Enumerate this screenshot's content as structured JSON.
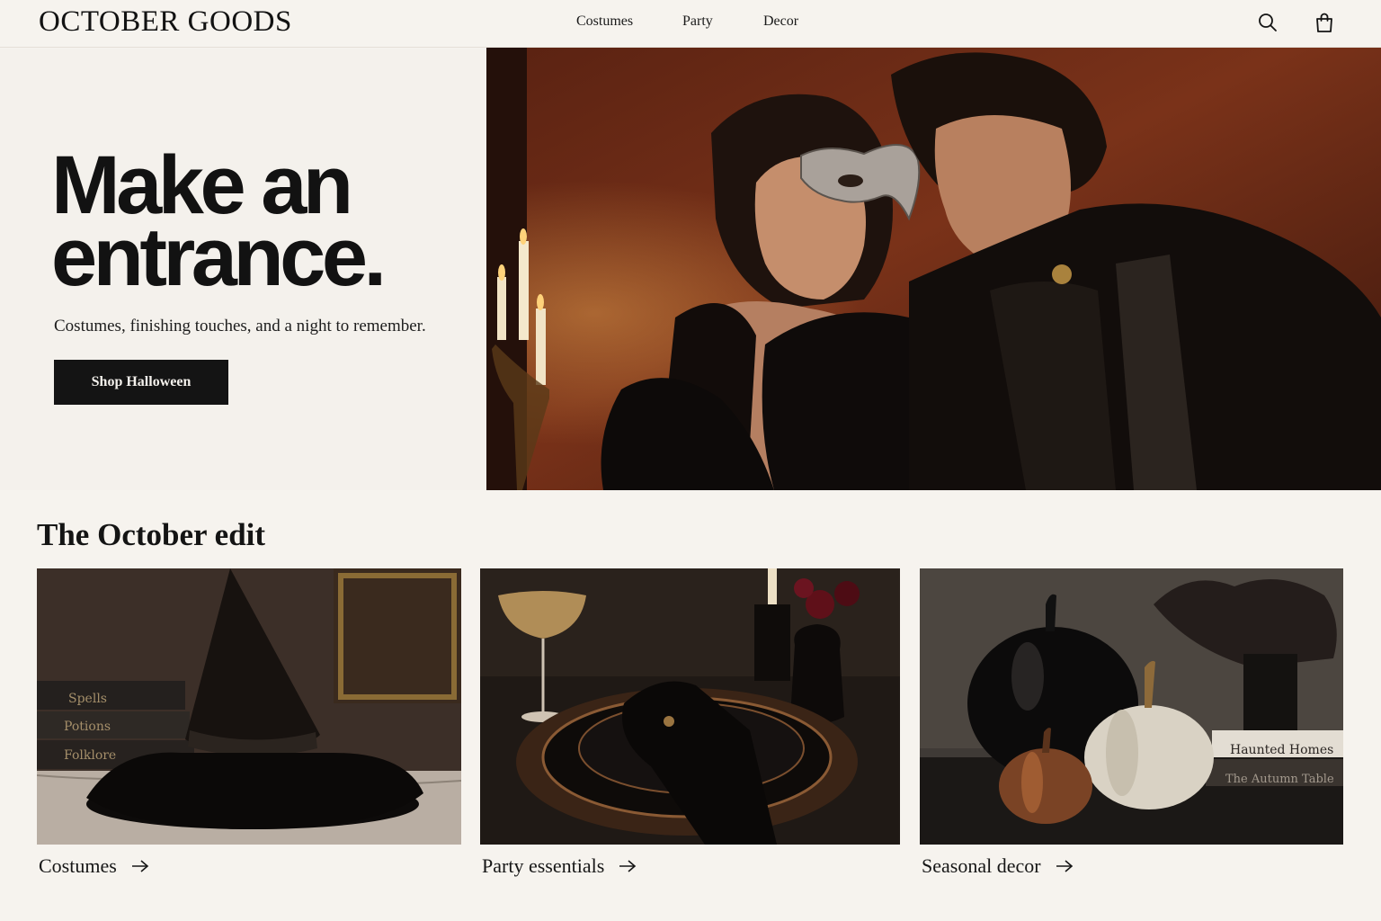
{
  "brand": {
    "logo": "OCTOBER GOODS"
  },
  "nav": {
    "items": [
      "Costumes",
      "Party",
      "Decor"
    ]
  },
  "header_icons": [
    "search-icon",
    "shopping-bag-icon"
  ],
  "hero": {
    "title_line1": "Make an",
    "title_line2": "entrance.",
    "subtitle": "Costumes, finishing touches, and a night to remember.",
    "cta_label": "Shop Halloween",
    "image": "couple-in-masquerade-costumes-photo"
  },
  "edit": {
    "title": "The October edit",
    "cards": [
      {
        "label": "Costumes",
        "image": "witch-hat-still-life-photo",
        "book_spines": [
          "Spells",
          "Potions",
          "Folklore"
        ]
      },
      {
        "label": "Party essentials",
        "image": "dark-table-setting-photo"
      },
      {
        "label": "Seasonal decor",
        "image": "pumpkins-decor-photo",
        "book_spines": [
          "Haunted Homes",
          "The Autumn Table"
        ]
      }
    ]
  },
  "colors": {
    "background": "#f6f3ee",
    "ink": "#141414",
    "button": "#141414",
    "hero_wall": "#6b2a17"
  }
}
